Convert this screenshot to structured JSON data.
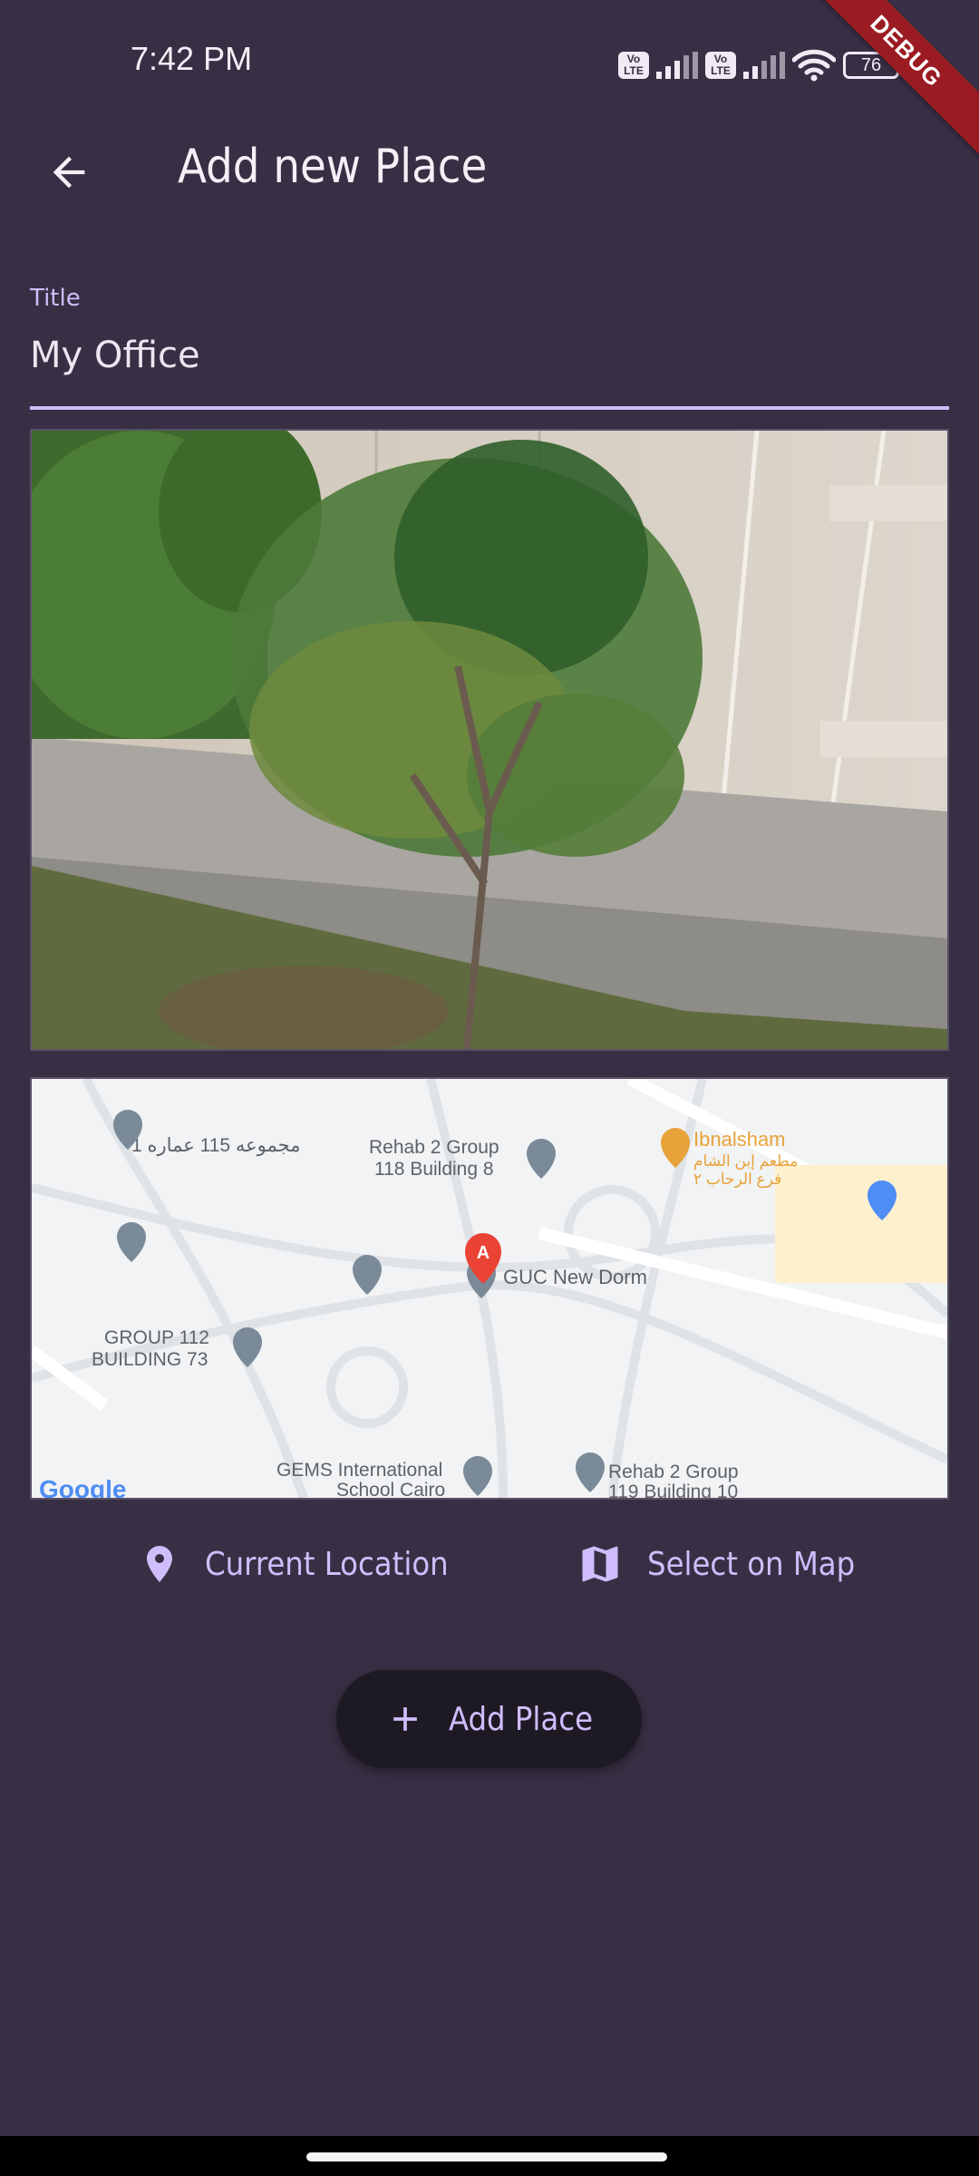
{
  "status_bar": {
    "time": "7:42 PM",
    "volte_label": "Vo LTE",
    "battery": "76",
    "debug_banner": "DEBUG"
  },
  "app_bar": {
    "back_icon": "arrow-back-icon",
    "title": "Add new Place"
  },
  "title_field": {
    "label": "Title",
    "value": "My Office"
  },
  "image_preview": {
    "description_icon": "photo"
  },
  "map_preview": {
    "labels": {
      "p1": "مجموعه 115 عماره 1",
      "p2_line1": "Rehab 2 Group",
      "p2_line2": "118 Building 8",
      "p3_en": "Ibnalsham",
      "p3_ar1": "مطعم إبن الشام",
      "p3_ar2": "فرع الرحاب ٢",
      "p4": "GUC New Dorm",
      "p5_line1": "GROUP 112",
      "p5_line2": "BUILDING 73",
      "p6_line1": "GEMS International",
      "p6_line2": "School Cairo",
      "p7_line1": "Rehab 2 Group",
      "p7_line2": "119 Building 10",
      "marker_letter": "A",
      "google": "Google"
    },
    "colors": {
      "marker": "#ea4335",
      "pin_gray": "#7a8a99",
      "pin_orange": "#e8a23a",
      "pin_blue": "#4f8df5"
    }
  },
  "actions": {
    "current_location_icon": "location-pin-icon",
    "current_location_label": "Current Location",
    "select_on_map_icon": "map-icon",
    "select_on_map_label": "Select on Map"
  },
  "add_button": {
    "icon": "plus-icon",
    "label": "Add Place"
  },
  "colors": {
    "background": "#372f43",
    "accent": "#cfbdfd",
    "button_bg": "#1e1a24"
  }
}
